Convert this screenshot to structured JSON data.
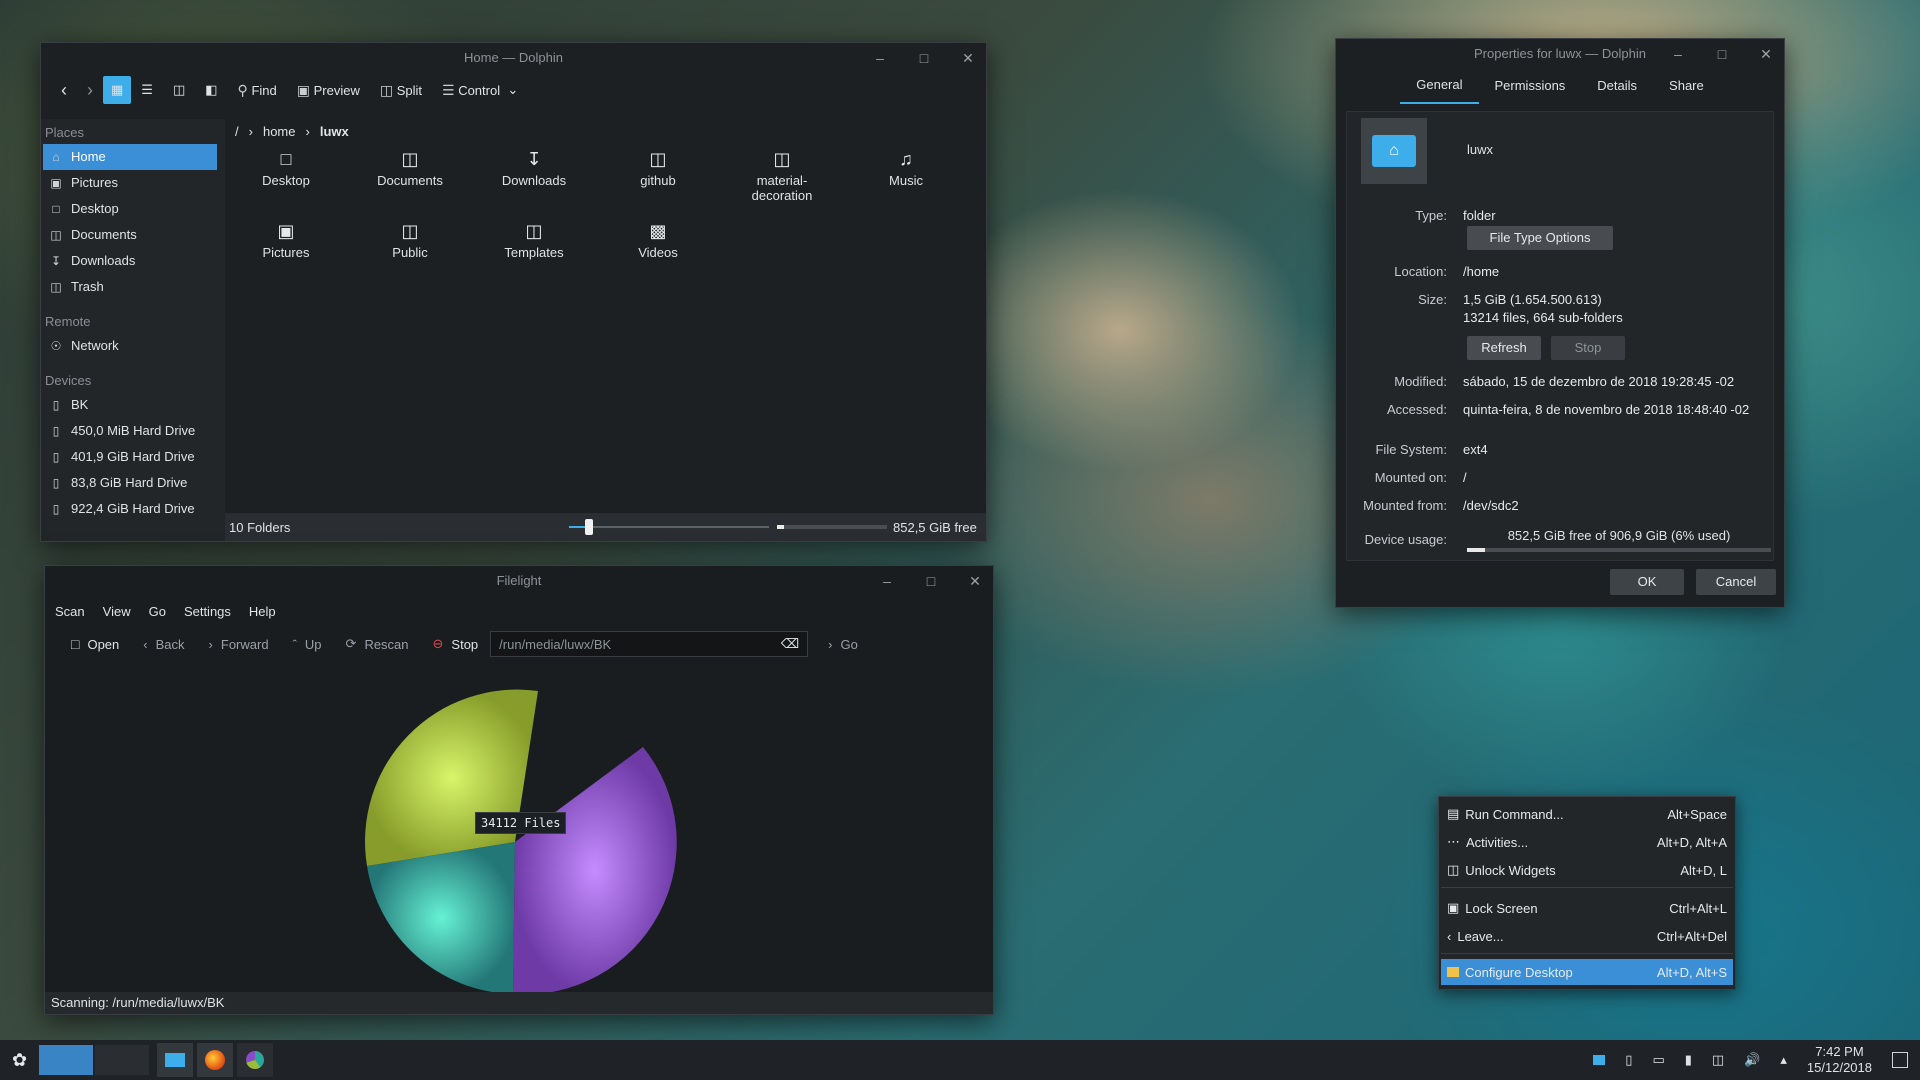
{
  "dolphin": {
    "title": "Home — Dolphin",
    "toolbar": {
      "find": "Find",
      "preview": "Preview",
      "split": "Split",
      "control": "Control"
    },
    "places_header": "Places",
    "places": [
      "Home",
      "Pictures",
      "Desktop",
      "Documents",
      "Downloads",
      "Trash"
    ],
    "remote_header": "Remote",
    "remote": [
      "Network"
    ],
    "devices_header": "Devices",
    "devices": [
      "BK",
      "450,0 MiB Hard Drive",
      "401,9 GiB Hard Drive",
      "83,8 GiB Hard Drive",
      "922,4 GiB Hard Drive"
    ],
    "breadcrumb": {
      "root": "/",
      "home": "home",
      "current": "luwx"
    },
    "files": [
      "Desktop",
      "Documents",
      "Downloads",
      "github",
      "material-\ndecoration",
      "Music",
      "Pictures",
      "Public",
      "Templates",
      "Videos"
    ],
    "status_count": "10 Folders",
    "zoom_fraction": 0.1,
    "status_free": "852,5 GiB free",
    "usage_fraction": 0.06
  },
  "props": {
    "title": "Properties for luwx — Dolphin",
    "tabs": [
      "General",
      "Permissions",
      "Details",
      "Share"
    ],
    "name": "luwx",
    "type_label": "Type:",
    "type": "folder",
    "file_type_options": "File Type Options",
    "location_label": "Location:",
    "location": "/home",
    "size_label": "Size:",
    "size": "1,5 GiB (1.654.500.613)",
    "size_detail": "13214 files, 664 sub-folders",
    "refresh": "Refresh",
    "stop": "Stop",
    "modified_label": "Modified:",
    "modified": "sábado, 15 de dezembro de 2018 19:28:45 -02",
    "accessed_label": "Accessed:",
    "accessed": "quinta-feira, 8 de novembro de 2018 18:48:40 -02",
    "filesystem_label": "File System:",
    "filesystem": "ext4",
    "mounted_on_label": "Mounted on:",
    "mounted_on": "/",
    "mounted_from_label": "Mounted from:",
    "mounted_from": "/dev/sdc2",
    "usage_label": "Device usage:",
    "usage": "852,5 GiB free of 906,9 GiB (6% used)",
    "usage_fraction": 0.06,
    "ok": "OK",
    "cancel": "Cancel"
  },
  "filelight": {
    "title": "Filelight",
    "menu": [
      "Scan",
      "View",
      "Go",
      "Settings",
      "Help"
    ],
    "toolbar": {
      "open": "Open",
      "back": "Back",
      "forward": "Forward",
      "up": "Up",
      "rescan": "Rescan",
      "stop": "Stop",
      "go": "Go"
    },
    "url": "/run/media/luwx/BK",
    "center_label": "34112 Files",
    "status": "Scanning: /run/media/luwx/BK",
    "colors": {
      "green": "#9bbb3a",
      "purple": "#8a4bc8",
      "teal": "#2aa79a"
    }
  },
  "ctx_menu": [
    {
      "label": "Run Command...",
      "shortcut": "Alt+Space",
      "icon": "run-icon"
    },
    {
      "label": "Activities...",
      "shortcut": "Alt+D, Alt+A",
      "icon": "activities-icon"
    },
    {
      "label": "Unlock Widgets",
      "shortcut": "Alt+D, L",
      "icon": "unlock-icon"
    },
    {
      "label": "Lock Screen",
      "shortcut": "Ctrl+Alt+L",
      "icon": "lock-icon"
    },
    {
      "label": "Leave...",
      "shortcut": "Ctrl+Alt+Del",
      "icon": "leave-icon"
    },
    {
      "label": "Configure Desktop",
      "shortcut": "Alt+D, Alt+S",
      "icon": "configure-icon"
    }
  ],
  "taskbar": {
    "time": "7:42 PM",
    "date": "15/12/2018"
  },
  "accent": "#3daee9"
}
